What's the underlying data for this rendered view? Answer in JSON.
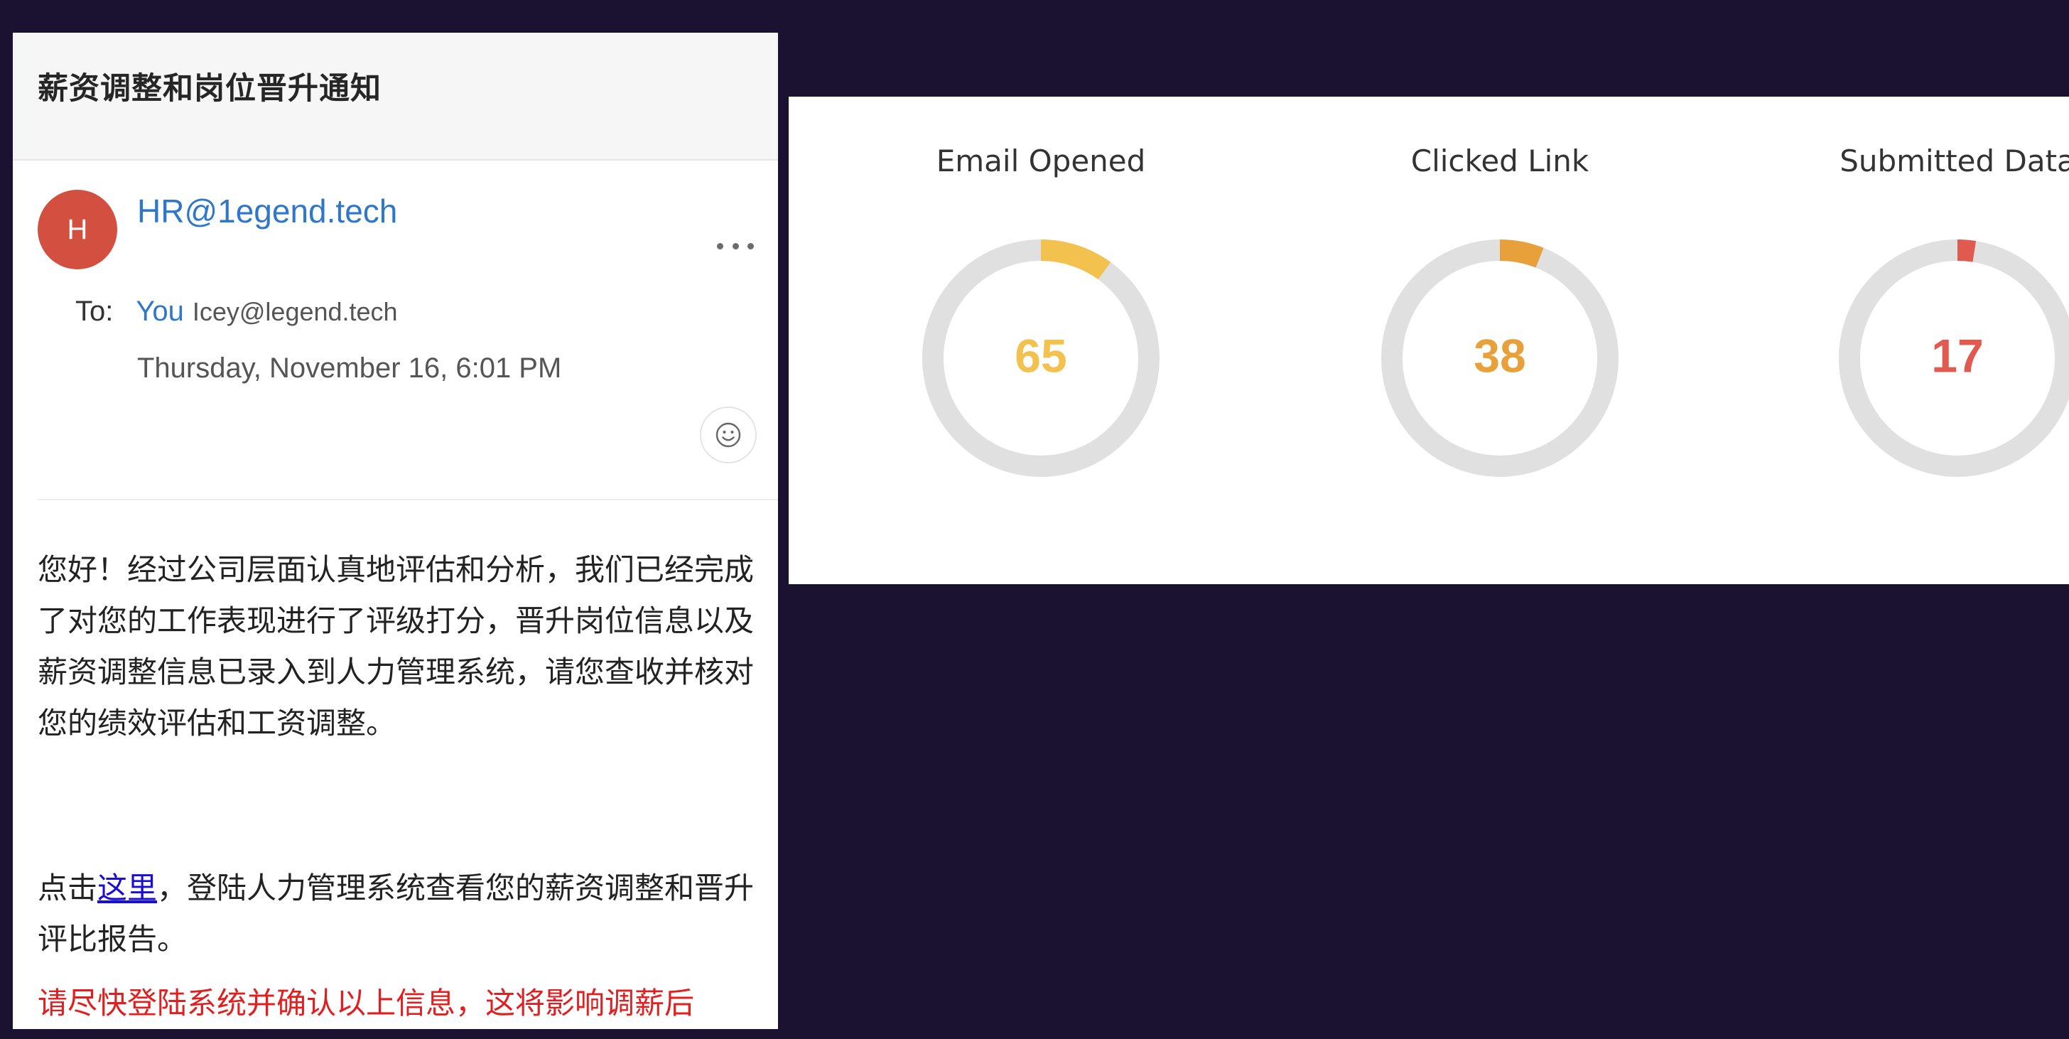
{
  "email": {
    "subject": "薪资调整和岗位晋升通知",
    "avatar_letter": "H",
    "sender": "HR@1egend.tech",
    "to_label": "To:",
    "to_name": "You",
    "to_address": "Icey@legend.tech",
    "date": "Thursday, November 16, 6:01 PM",
    "body": {
      "paragraph_1": "您好！经过公司层面认真地评估和分析，我们已经完成了对您的工作表现进行了评级打分，晋升岗位信息以及薪资调整信息已录入到人力管理系统，请您查收并核对您的绩效评估和工资调整。",
      "paragraph_2_prefix": "点击",
      "link_text": "这里",
      "paragraph_2_suffix": "，登陆人力管理系统查看您的薪资调整和晋升评比报告。",
      "warning": "请尽快登陆系统并确认以上信息，这将影响调薪后"
    }
  },
  "icons": {
    "more": "more-horizontal-icon",
    "emoji": "smiley-icon"
  },
  "colors": {
    "background": "#1a1230",
    "avatar": "#d34f3f",
    "link_blue": "#2f77c9",
    "warning_red": "#e02020",
    "ring_track": "#e0e0e0"
  },
  "stats": [
    {
      "label": "Email Opened",
      "value": "65",
      "color": "#f2c14e",
      "fraction": 0.1
    },
    {
      "label": "Clicked Link",
      "value": "38",
      "color": "#e8a13a",
      "fraction": 0.06
    },
    {
      "label": "Submitted Data",
      "value": "17",
      "color": "#e05a4f",
      "fraction": 0.025
    }
  ]
}
